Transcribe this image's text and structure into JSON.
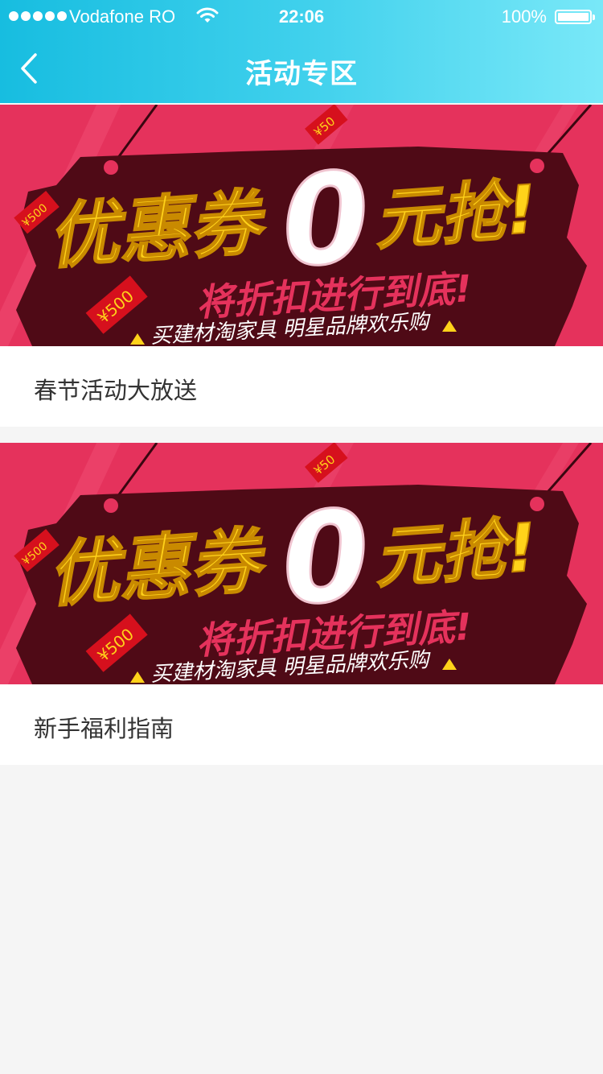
{
  "status_bar": {
    "carrier": "Vodafone RO",
    "time": "22:06",
    "battery_percent": "100%"
  },
  "nav": {
    "title": "活动专区",
    "back_icon": "chevron-left-icon"
  },
  "colors": {
    "header_gradient_start": "#17bde0",
    "header_gradient_end": "#79e8f8",
    "banner_pink": "#e5325c",
    "banner_maroon": "#4f0a16",
    "banner_yellow": "#ffd21a"
  },
  "banner": {
    "headline_1": "优惠券",
    "headline_zero": "0",
    "headline_2": "元抢!",
    "subline": "将折扣进行到底!",
    "tagline": "买建材淘家具 明星品牌欢乐购",
    "tag_price_large": "¥500",
    "tag_price_small": "¥50",
    "tag_price_left": "¥500"
  },
  "cards": [
    {
      "title": "春节活动大放送"
    },
    {
      "title": "新手福利指南"
    }
  ]
}
